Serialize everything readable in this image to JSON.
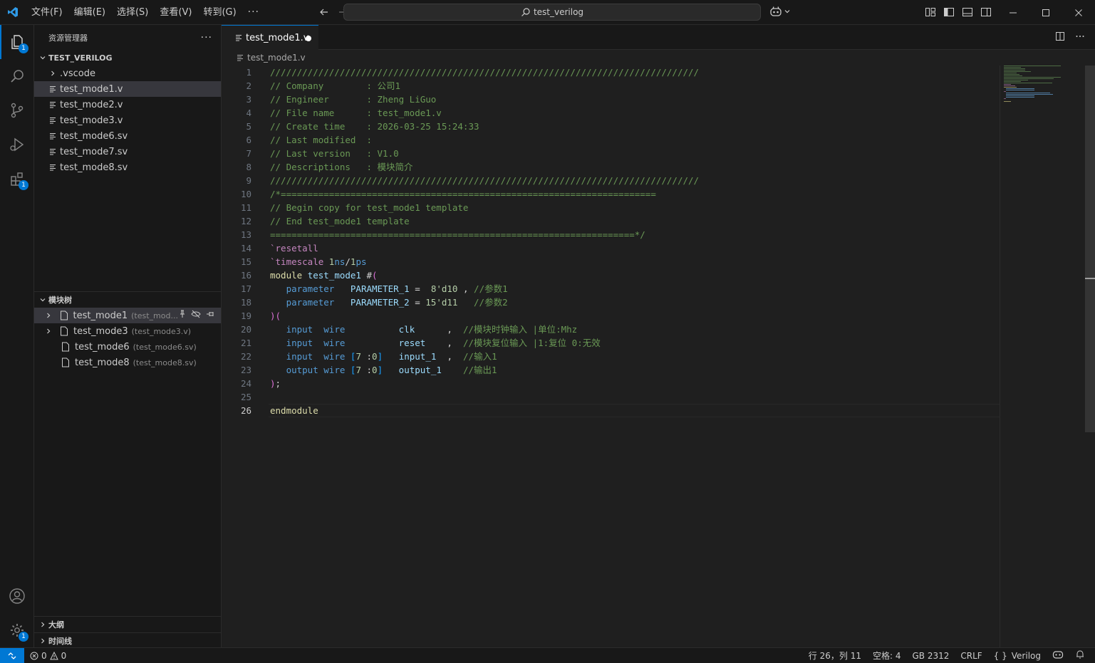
{
  "title_bar": {
    "menu": [
      "文件(F)",
      "编辑(E)",
      "选择(S)",
      "查看(V)",
      "转到(G)"
    ],
    "more": "···",
    "search_text": "test_verilog"
  },
  "activity_bar": {
    "explorer_badge": "1",
    "extensions_badge": "1",
    "settings_badge": "1"
  },
  "sidebar": {
    "header": "资源管理器",
    "more": "···",
    "workspace": "TEST_VERILOG",
    "items": [
      ".vscode",
      "test_mode1.v",
      "test_mode2.v",
      "test_mode3.v",
      "test_mode6.sv",
      "test_mode7.sv",
      "test_mode8.sv"
    ],
    "module_tree": {
      "title": "模块树",
      "items": [
        {
          "name": "test_mode1",
          "path": "(test_mod..."
        },
        {
          "name": "test_mode3",
          "path": "(test_mode3.v)"
        },
        {
          "name": "test_mode6",
          "path": "(test_mode6.sv)"
        },
        {
          "name": "test_mode8",
          "path": "(test_mode8.sv)"
        }
      ]
    },
    "outline": "大纲",
    "timeline": "时间线"
  },
  "editor": {
    "tab_label": "test_mode1.v",
    "breadcrumb": "test_mode1.v",
    "current_line": "26"
  },
  "status_bar": {
    "errors": "0",
    "warnings": "0",
    "position": "行 26，列 11",
    "indent": "空格: 4",
    "encoding": "GB 2312",
    "eol": "CRLF",
    "language": "Verilog"
  },
  "colors": {
    "accent": "#0078d4",
    "comment": "#6a9955",
    "keyword": "#c586c0"
  }
}
